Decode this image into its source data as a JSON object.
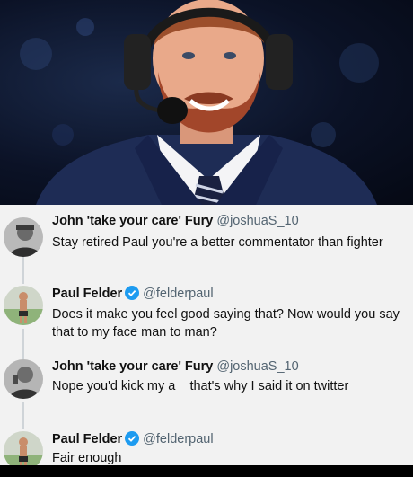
{
  "colors": {
    "verified_badge": "#1d9bf0",
    "handle_gray": "#536471",
    "feed_background": "#f2f2f2"
  },
  "hero": {
    "description_icon": "commentator-photo"
  },
  "tweets": [
    {
      "name": "John 'take your care' Fury",
      "handle": "@joshuaS_10",
      "verified": false,
      "avatar_icon": "user-avatar-icon",
      "text": "Stay retired Paul you're a better commentator than fighter"
    },
    {
      "name": "Paul Felder",
      "handle": "@felderpaul",
      "verified": true,
      "avatar_icon": "user-avatar-icon",
      "text": "Does it make you feel good saying that? Now would you say that to my face man to man?"
    },
    {
      "name": "John 'take your care' Fury",
      "handle": "@joshuaS_10",
      "verified": false,
      "avatar_icon": "user-avatar-icon",
      "text": "Nope you'd kick my a    that's why I said it on twitter"
    },
    {
      "name": "Paul Felder",
      "handle": "@felderpaul",
      "verified": true,
      "avatar_icon": "user-avatar-icon",
      "text": "Fair enough"
    }
  ]
}
